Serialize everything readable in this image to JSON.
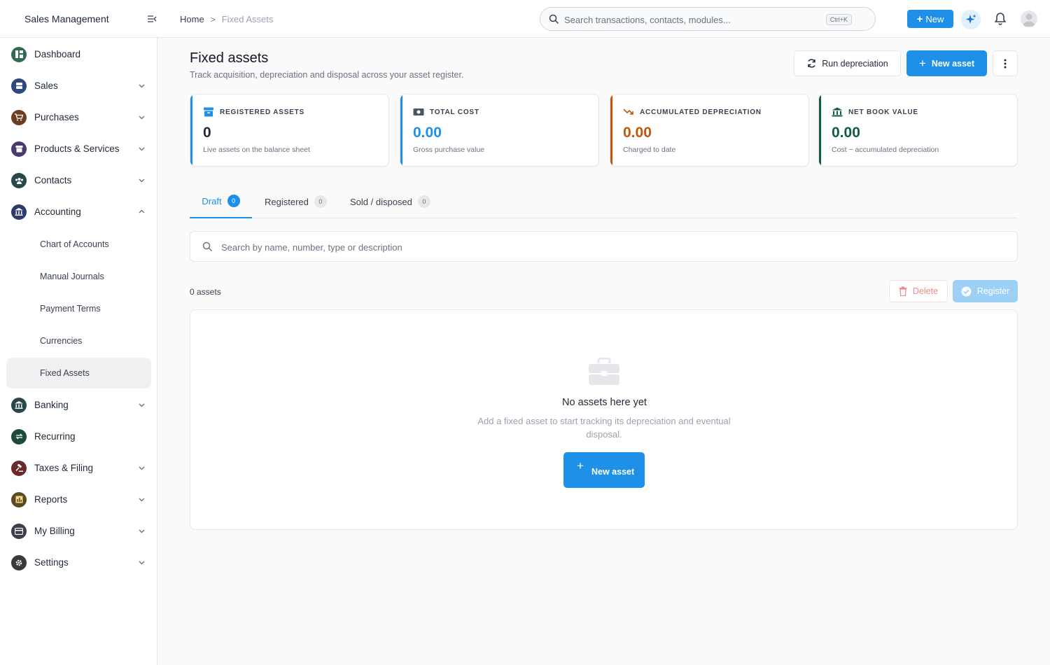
{
  "app": {
    "title": "Sales Management",
    "breadcrumb": {
      "home": "Home",
      "separator": ">",
      "current": "Fixed Assets"
    },
    "search": {
      "placeholder": "Search transactions, contacts, modules...",
      "shortcut": "Ctrl+K"
    },
    "new_label": "New",
    "icons": {
      "ai": "sparkles-icon",
      "notifications": "bell-icon",
      "user": "avatar-icon"
    }
  },
  "sidebar": {
    "items": [
      {
        "label": "Dashboard",
        "icon": "dashboard-icon",
        "color": "#2f6b4f",
        "expandable": false
      },
      {
        "label": "Sales",
        "icon": "sales-icon",
        "color": "#2e4a7d",
        "expandable": true
      },
      {
        "label": "Purchases",
        "icon": "cart-icon",
        "color": "#6b3f1f",
        "expandable": true
      },
      {
        "label": "Products & Services",
        "icon": "box-icon",
        "color": "#4a3a6b",
        "expandable": true
      },
      {
        "label": "Contacts",
        "icon": "users-icon",
        "color": "#27474a",
        "expandable": true
      },
      {
        "label": "Accounting",
        "icon": "bank-icon",
        "color": "#2e3a6b",
        "expandable": true,
        "expanded": true
      }
    ],
    "subitems": [
      {
        "label": "Chart of Accounts"
      },
      {
        "label": "Manual Journals"
      },
      {
        "label": "Payment Terms"
      },
      {
        "label": "Currencies"
      },
      {
        "label": "Fixed Assets",
        "active": true
      }
    ],
    "items_after": [
      {
        "label": "Banking",
        "icon": "bank-icon",
        "color": "#27474a",
        "expandable": true
      },
      {
        "label": "Recurring",
        "icon": "repeat-icon",
        "color": "#1f4a3a",
        "expandable": false
      },
      {
        "label": "Taxes & Filing",
        "icon": "gavel-icon",
        "color": "#6b2a2a",
        "expandable": true
      },
      {
        "label": "Reports",
        "icon": "report-icon",
        "color": "#5a4a1f",
        "expandable": true
      },
      {
        "label": "My Billing",
        "icon": "card-icon",
        "color": "#3a3f4a",
        "expandable": true
      },
      {
        "label": "Settings",
        "icon": "gear-icon",
        "color": "#3a3a3a",
        "expandable": true
      }
    ]
  },
  "page": {
    "title": "Fixed assets",
    "subtitle": "Track acquisition, depreciation and disposal across your asset register.",
    "run_depreciation_label": "Run depreciation",
    "new_asset_label": "New asset"
  },
  "cards": [
    {
      "label": "REGISTERED ASSETS",
      "value": "0",
      "note": "Live assets on the balance sheet",
      "color": "#1f2937",
      "accent": "#1e90e8",
      "icon": "archive-icon"
    },
    {
      "label": "TOTAL COST",
      "value": "0.00",
      "note": "Gross purchase value",
      "color": "#1e90e8",
      "accent": "#1e90e8",
      "icon": "money-icon"
    },
    {
      "label": "ACCUMULATED DEPRECIATION",
      "value": "0.00",
      "note": "Charged to date",
      "color": "#c2570c",
      "accent": "#c2570c",
      "icon": "trend-down-icon"
    },
    {
      "label": "NET BOOK VALUE",
      "value": "0.00",
      "note": "Cost − accumulated depreciation",
      "color": "#0f5c46",
      "accent": "#0f5c46",
      "icon": "bank-icon"
    }
  ],
  "tabs": [
    {
      "label": "Draft",
      "count": "0",
      "active": true
    },
    {
      "label": "Registered",
      "count": "0"
    },
    {
      "label": "Sold / disposed",
      "count": "0"
    }
  ],
  "filter": {
    "placeholder": "Search by name, number, type or description"
  },
  "list": {
    "count_label": "0 assets",
    "delete_label": "Delete",
    "register_label": "Register"
  },
  "empty_state": {
    "title": "No assets here yet",
    "description": "Add a fixed asset to start tracking its depreciation and eventual disposal.",
    "button_label": "New asset",
    "icon": "briefcase-icon"
  }
}
